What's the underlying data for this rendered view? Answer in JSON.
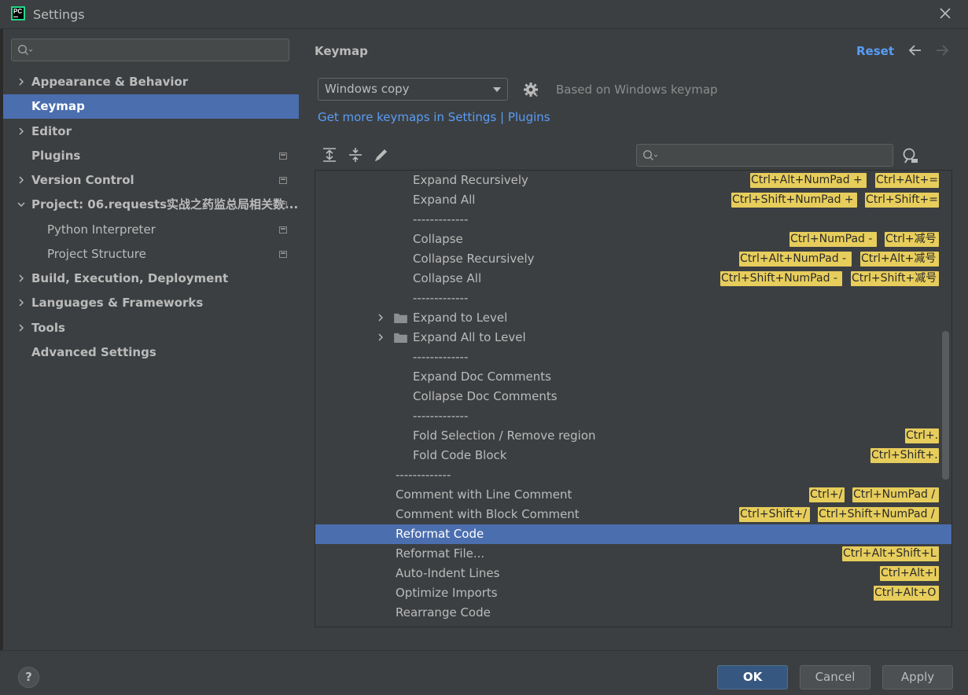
{
  "window": {
    "title": "Settings"
  },
  "sidebar": {
    "search_placeholder": "",
    "items": [
      {
        "label": "Appearance & Behavior",
        "expandable": true
      },
      {
        "label": "Keymap",
        "selected": true
      },
      {
        "label": "Editor",
        "expandable": true
      },
      {
        "label": "Plugins",
        "modified": true
      },
      {
        "label": "Version Control",
        "expandable": true,
        "modified": true
      },
      {
        "label": "Project: 06.requests实战之药监总局相关数...",
        "expanded": true,
        "modified": true
      },
      {
        "label": "Python Interpreter",
        "modified": true
      },
      {
        "label": "Project Structure",
        "modified": true
      },
      {
        "label": "Build, Execution, Deployment",
        "expandable": true
      },
      {
        "label": "Languages & Frameworks",
        "expandable": true
      },
      {
        "label": "Tools",
        "expandable": true
      },
      {
        "label": "Advanced Settings"
      }
    ]
  },
  "main": {
    "heading": "Keymap",
    "reset": "Reset",
    "keymap_selected": "Windows copy",
    "based_on": "Based on Windows keymap",
    "more_keymaps_link": "Get more keymaps in Settings | Plugins",
    "search_placeholder": ""
  },
  "actions": [
    {
      "label": "Expand Recursively",
      "shortcuts": [
        "Ctrl+Alt+NumPad +",
        "Ctrl+Alt+="
      ]
    },
    {
      "label": "Expand All",
      "shortcuts": [
        "Ctrl+Shift+NumPad +",
        "Ctrl+Shift+="
      ]
    },
    {
      "label": "-------------",
      "shortcuts": []
    },
    {
      "label": "Collapse",
      "shortcuts": [
        "Ctrl+NumPad -",
        "Ctrl+减号"
      ]
    },
    {
      "label": "Collapse Recursively",
      "shortcuts": [
        "Ctrl+Alt+NumPad -",
        "Ctrl+Alt+减号"
      ]
    },
    {
      "label": "Collapse All",
      "shortcuts": [
        "Ctrl+Shift+NumPad -",
        "Ctrl+Shift+减号"
      ]
    },
    {
      "label": "-------------",
      "shortcuts": []
    },
    {
      "label": "Expand to Level",
      "shortcuts": [],
      "folder": true
    },
    {
      "label": "Expand All to Level",
      "shortcuts": [],
      "folder": true
    },
    {
      "label": "-------------",
      "shortcuts": []
    },
    {
      "label": "Expand Doc Comments",
      "shortcuts": []
    },
    {
      "label": "Collapse Doc Comments",
      "shortcuts": []
    },
    {
      "label": "-------------",
      "shortcuts": []
    },
    {
      "label": "Fold Selection / Remove region",
      "shortcuts": [
        "Ctrl+."
      ]
    },
    {
      "label": "Fold Code Block",
      "shortcuts": [
        "Ctrl+Shift+."
      ]
    },
    {
      "label": "-------------",
      "shortcuts": []
    },
    {
      "label": "Comment with Line Comment",
      "shortcuts": [
        "Ctrl+/",
        "Ctrl+NumPad /"
      ]
    },
    {
      "label": "Comment with Block Comment",
      "shortcuts": [
        "Ctrl+Shift+/",
        "Ctrl+Shift+NumPad /"
      ]
    },
    {
      "label": "Reformat Code",
      "shortcuts": [],
      "selected": true
    },
    {
      "label": "Reformat File...",
      "shortcuts": [
        "Ctrl+Alt+Shift+L"
      ]
    },
    {
      "label": "Auto-Indent Lines",
      "shortcuts": [
        "Ctrl+Alt+I"
      ]
    },
    {
      "label": "Optimize Imports",
      "shortcuts": [
        "Ctrl+Alt+O"
      ]
    },
    {
      "label": "Rearrange Code",
      "shortcuts": []
    }
  ],
  "footer": {
    "help": "?",
    "ok": "OK",
    "cancel": "Cancel",
    "apply": "Apply"
  },
  "colors": {
    "accent": "#4b6eaf",
    "link": "#589df6",
    "shortcut_badge": "#e7cd5b"
  }
}
